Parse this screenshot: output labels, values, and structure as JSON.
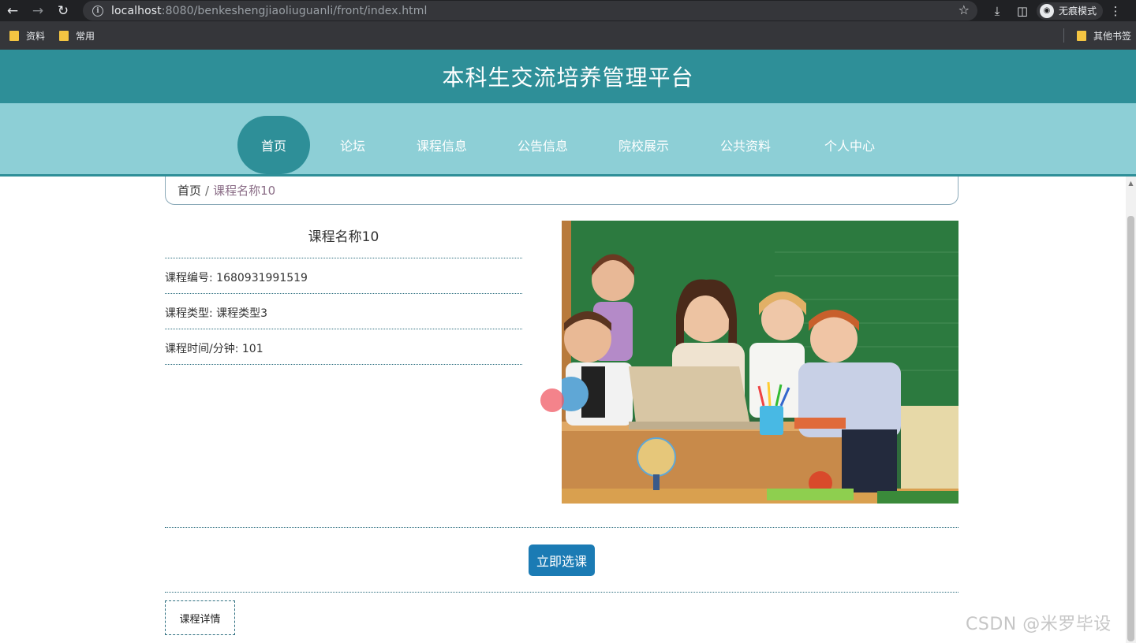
{
  "browser": {
    "url_host": "localhost",
    "url_path": ":8080/benkeshengjiaoliuguanli/front/index.html",
    "incognito_label": "无痕模式",
    "bookmarks": [
      "资料",
      "常用"
    ],
    "other_bookmarks": "其他书签"
  },
  "site": {
    "title": "本科生交流培养管理平台",
    "nav": [
      "首页",
      "论坛",
      "课程信息",
      "公告信息",
      "院校展示",
      "公共资料",
      "个人中心"
    ]
  },
  "breadcrumb": {
    "home": "首页",
    "separator": "/",
    "current": "课程名称10"
  },
  "course": {
    "title": "课程名称10",
    "fields": [
      {
        "label": "课程编号",
        "value": "1680931991519"
      },
      {
        "label": "课程类型",
        "value": "课程类型3"
      },
      {
        "label": "课程时间/分钟",
        "value": "101"
      }
    ],
    "fields_text": [
      "课程编号: 1680931991519",
      "课程类型: 课程类型3",
      "课程时间/分钟: 101"
    ],
    "enroll_button": "立即选课",
    "detail_tab": "课程详情"
  },
  "watermark": "CSDN @米罗毕设"
}
